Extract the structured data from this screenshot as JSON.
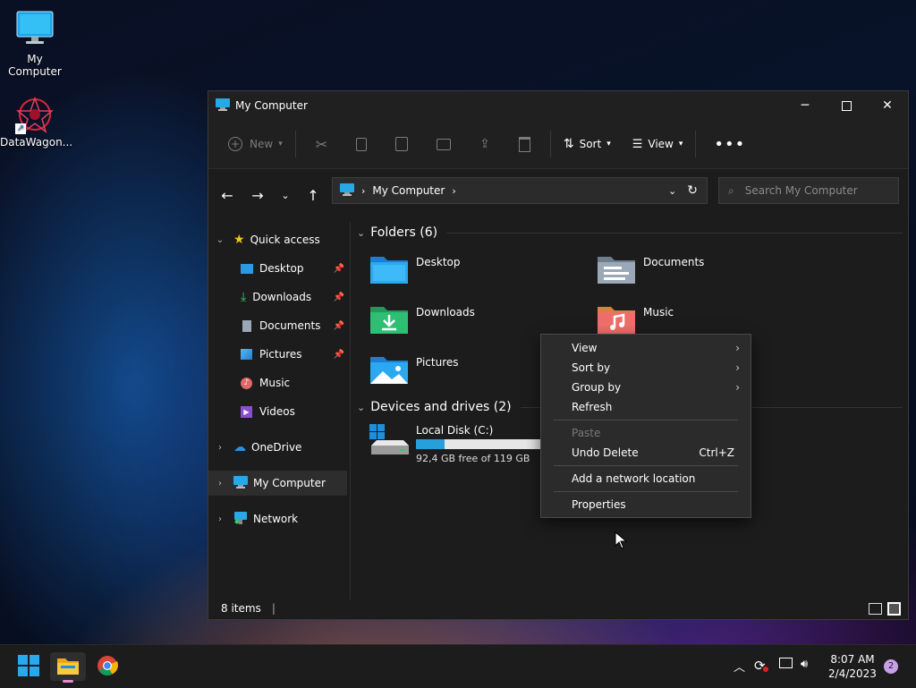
{
  "desktop": {
    "icons": [
      {
        "label": "My Computer"
      },
      {
        "label": "DataWagon..."
      }
    ]
  },
  "window": {
    "title": "My Computer",
    "toolbar": {
      "new_label": "New",
      "sort_label": "Sort",
      "view_label": "View"
    },
    "address": {
      "location": "My Computer"
    },
    "search": {
      "placeholder": "Search My Computer"
    },
    "sidebar": {
      "quick_access": "Quick access",
      "items": [
        {
          "label": "Desktop"
        },
        {
          "label": "Downloads"
        },
        {
          "label": "Documents"
        },
        {
          "label": "Pictures"
        },
        {
          "label": "Music"
        },
        {
          "label": "Videos"
        }
      ],
      "onedrive": "OneDrive",
      "my_computer": "My Computer",
      "network": "Network"
    },
    "content": {
      "folders_header": "Folders (6)",
      "folders": [
        {
          "label": "Desktop"
        },
        {
          "label": "Documents"
        },
        {
          "label": "Downloads"
        },
        {
          "label": "Music"
        },
        {
          "label": "Pictures"
        }
      ],
      "drives_header": "Devices and drives (2)",
      "drive": {
        "name": "Local Disk (C:)",
        "free": "92,4 GB free of 119 GB",
        "used_fraction": 0.224
      }
    },
    "status": {
      "items": "8 items"
    }
  },
  "context_menu": {
    "view": "View",
    "sort_by": "Sort by",
    "group_by": "Group by",
    "refresh": "Refresh",
    "paste": "Paste",
    "undo_delete": "Undo Delete",
    "undo_shortcut": "Ctrl+Z",
    "add_network": "Add a network location",
    "properties": "Properties"
  },
  "taskbar": {
    "time": "8:07 AM",
    "date": "2/4/2023",
    "notification_count": "2"
  },
  "colors": {
    "accent": "#0078d4",
    "drive_bar": "#26a0da"
  }
}
